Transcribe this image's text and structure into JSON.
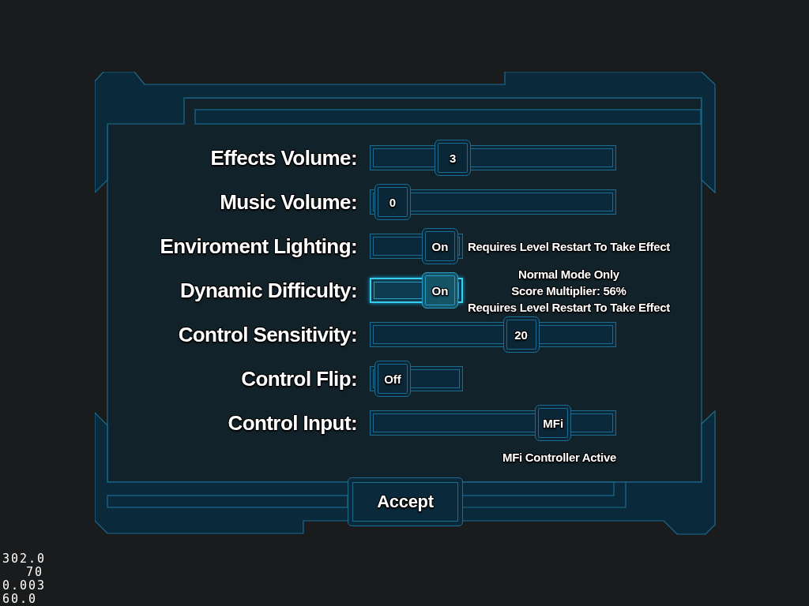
{
  "settings": [
    {
      "kind": "slider",
      "label": "Effects Volume:",
      "value": "3",
      "level": 0.3,
      "selected": false
    },
    {
      "kind": "slider",
      "label": "Music Volume:",
      "value": "0",
      "level": 0,
      "selected": false
    },
    {
      "kind": "toggle",
      "label": "Enviroment Lighting:",
      "value": "On",
      "on": true,
      "selected": false,
      "note": [
        "Requires Level Restart To Take Effect"
      ]
    },
    {
      "kind": "toggle",
      "label": "Dynamic Difficulty:",
      "value": "On",
      "on": true,
      "selected": true,
      "note": [
        "Normal Mode Only",
        "Score Multiplier: 56%",
        "Requires Level Restart To Take Effect"
      ]
    },
    {
      "kind": "slider",
      "label": "Control Sensitivity:",
      "value": "20",
      "level": 0.64,
      "selected": false
    },
    {
      "kind": "toggle",
      "label": "Control Flip:",
      "value": "Off",
      "on": false,
      "selected": false
    },
    {
      "kind": "slider",
      "label": "Control Input:",
      "value": "MFi",
      "level": 0.8,
      "selected": false,
      "status": "MFi Controller Active"
    }
  ],
  "accept_button": {
    "label": "Accept"
  },
  "debug_overlay": {
    "lines": [
      "302.0",
      "70",
      "0.003",
      "60.0"
    ]
  }
}
